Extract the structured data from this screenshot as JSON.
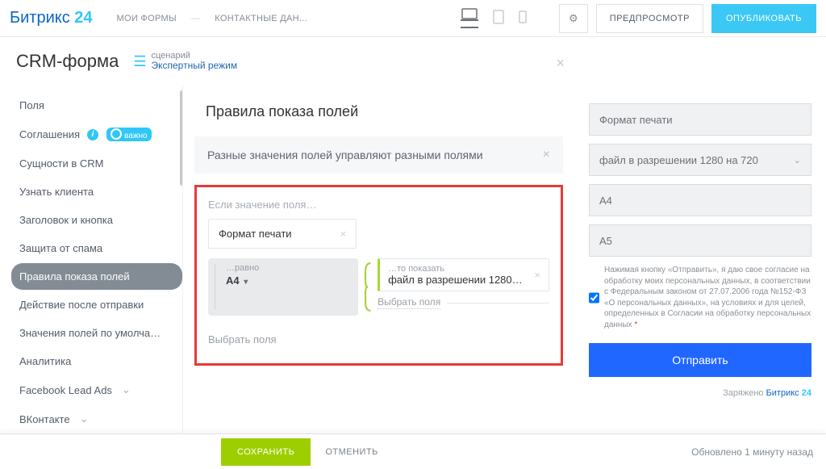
{
  "top": {
    "logo_a": "Битрикс",
    "logo_b": "24",
    "tab_forms": "МОИ ФОРМЫ",
    "tab_contact": "КОНТАКТНЫЕ ДАН...",
    "preview": "ПРЕДПРОСМОТР",
    "publish": "ОПУБЛИКОВАТЬ"
  },
  "subhead": {
    "title": "CRM-форма",
    "scenario_label": "сценарий",
    "scenario_link": "Экспертный режим"
  },
  "sidebar": {
    "items": [
      "Поля",
      "Соглашения",
      "Сущности в CRM",
      "Узнать клиента",
      "Заголовок и кнопка",
      "Защита от спама",
      "Правила показа полей",
      "Действие после отправки",
      "Значения полей по умолча…",
      "Аналитика",
      "Facebook Lead Ads",
      "ВКонтакте"
    ],
    "important": "важно"
  },
  "content": {
    "title": "Правила показа полей",
    "subrule": "Разные значения полей управляют разными полями",
    "if_label": "Если значение поля…",
    "field_name": "Формат печати",
    "eq_label": "…равно",
    "eq_value": "A4",
    "then_label": "…то показать",
    "then_value": "файл в разрешении 1280…",
    "select_fields": "Выбрать поля",
    "select_fields2": "Выбрать поля"
  },
  "preview": {
    "f1": "Формат печати",
    "f2": "файл в разрешении 1280 на 720",
    "f3": "A4",
    "f4": "A5",
    "consent": "Нажимая кнопку «Отправить», я даю свое согласие на обработку моих персональных данных, в соответствии с Федеральным законом от 27.07.2006 года №152-ФЗ «О персональных данных», на условиях и для целей, определенных в Согласии на обработку персональных данных",
    "submit": "Отправить",
    "powered": "Заряжено",
    "b24a": "Битрикс",
    "b24b": "24"
  },
  "footer": {
    "save": "СОХРАНИТЬ",
    "cancel": "ОТМЕНИТЬ",
    "updated": "Обновлено 1 минуту назад"
  }
}
